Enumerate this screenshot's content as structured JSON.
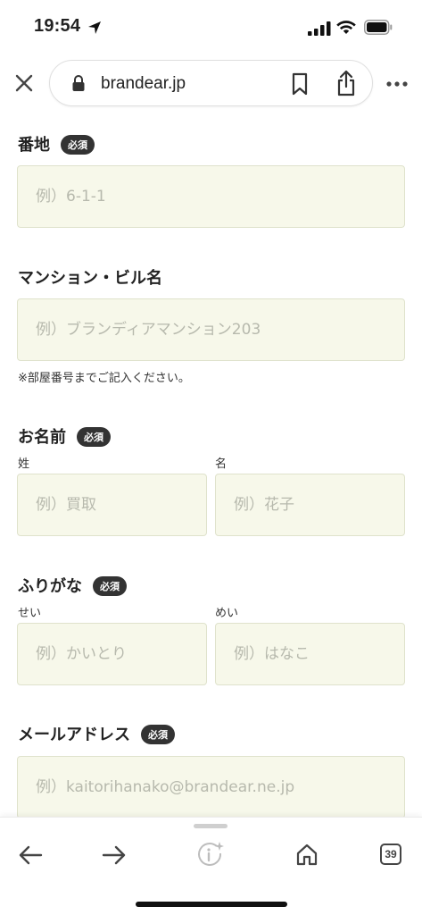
{
  "status_bar": {
    "time": "19:54"
  },
  "browser": {
    "url": "brandear.jp"
  },
  "form": {
    "required_badge": "必須",
    "address": {
      "label": "番地",
      "placeholder": "例）6-1-1"
    },
    "building": {
      "label": "マンション・ビル名",
      "placeholder": "例）ブランディアマンション203",
      "note": "※部屋番号までご記入ください。"
    },
    "name": {
      "label": "お名前",
      "last_label": "姓",
      "last_placeholder": "例）買取",
      "first_label": "名",
      "first_placeholder": "例）花子"
    },
    "furigana": {
      "label": "ふりがな",
      "last_label": "せい",
      "last_placeholder": "例）かいとり",
      "first_label": "めい",
      "first_placeholder": "例）はなこ"
    },
    "email": {
      "label": "メールアドレス",
      "placeholder": "例）kaitorihanako@brandear.ne.jp"
    }
  },
  "toolbar": {
    "tab_count": "39"
  }
}
